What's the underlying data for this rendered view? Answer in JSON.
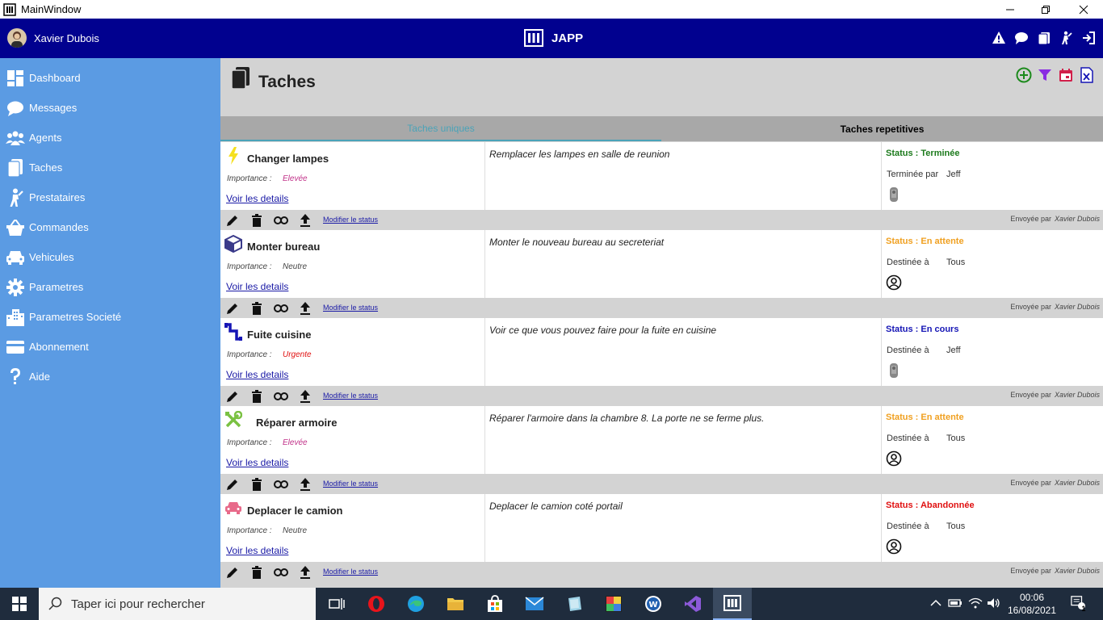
{
  "window": {
    "title": "MainWindow"
  },
  "header": {
    "user_name": "Xavier Dubois",
    "brand": "JAPP"
  },
  "sidebar": {
    "items": [
      {
        "label": "Dashboard",
        "icon": "dashboard-icon"
      },
      {
        "label": "Messages",
        "icon": "chat-icon"
      },
      {
        "label": "Agents",
        "icon": "people-icon"
      },
      {
        "label": "Taches",
        "icon": "clipboard-icon"
      },
      {
        "label": "Prestataires",
        "icon": "worker-icon"
      },
      {
        "label": "Commandes",
        "icon": "basket-icon"
      },
      {
        "label": "Vehicules",
        "icon": "car-icon"
      },
      {
        "label": "Parametres",
        "icon": "gear-icon"
      },
      {
        "label": "Parametres Societé",
        "icon": "building-icon"
      },
      {
        "label": "Abonnement",
        "icon": "credit-card-icon"
      },
      {
        "label": "Aide",
        "icon": "question-icon"
      }
    ]
  },
  "page": {
    "title": "Taches"
  },
  "tabs": [
    {
      "label": "Taches uniques",
      "active": true
    },
    {
      "label": "Taches repetitives",
      "active": false
    }
  ],
  "colors": {
    "header_bg": "#01018f",
    "sidebar_bg": "#5b9be3",
    "main_bg": "#d3d3d3",
    "tab_active": "#4aa3b8",
    "status_terminee": "#1c7a1c",
    "status_attente": "#f0a020",
    "status_cours": "#1515b5",
    "status_abandonnee": "#e01010"
  },
  "tasks": [
    {
      "name": "Changer lampes",
      "icon": "lightning-icon",
      "importance_label": "Importance :",
      "importance": "Elevée",
      "importance_color": "#c03088",
      "details_link": "Voir les details",
      "description": "Remplacer les lampes en salle de reunion",
      "status": "Status : Terminée",
      "status_color": "#1c7a1c",
      "assign_label": "Terminée par",
      "assign_value": "Jeff",
      "assignee_avatar": "photo-avatar",
      "modify_link": "Modifier le status",
      "sent_by_label": "Envoyée par",
      "sent_by": "Xavier Dubois"
    },
    {
      "name": "Monter bureau",
      "icon": "box-icon",
      "importance_label": "Importance :",
      "importance": "Neutre",
      "importance_color": "#444444",
      "details_link": "Voir les details",
      "description": "Monter le nouveau bureau au secreteriat",
      "status": "Status : En attente",
      "status_color": "#f0a020",
      "assign_label": "Destinée à",
      "assign_value": "Tous",
      "assignee_avatar": "user-circle-icon",
      "modify_link": "Modifier le status",
      "sent_by_label": "Envoyée par",
      "sent_by": "Xavier Dubois"
    },
    {
      "name": "Fuite cuisine",
      "icon": "pipe-icon",
      "importance_label": "Importance :",
      "importance": "Urgente",
      "importance_color": "#e01010",
      "details_link": "Voir les details",
      "description": "Voir ce que vous pouvez faire pour la fuite en cuisine",
      "status": "Status : En cours",
      "status_color": "#1515b5",
      "assign_label": "Destinée à",
      "assign_value": "Jeff",
      "assignee_avatar": "photo-avatar",
      "modify_link": "Modifier le status",
      "sent_by_label": "Envoyée par",
      "sent_by": "Xavier Dubois"
    },
    {
      "name": "Réparer armoire",
      "icon": "tools-icon",
      "importance_label": "Importance :",
      "importance": "Elevée",
      "importance_color": "#c03088",
      "details_link": "Voir les details",
      "description": "Réparer l'armoire dans la chambre 8. La porte ne se ferme plus.",
      "status": "Status : En attente",
      "status_color": "#f0a020",
      "assign_label": "Destinée à",
      "assign_value": "Tous",
      "assignee_avatar": "user-circle-icon",
      "modify_link": "Modifier le status",
      "sent_by_label": "Envoyée par",
      "sent_by": "Xavier Dubois"
    },
    {
      "name": "Deplacer le camion",
      "icon": "car-icon",
      "importance_label": "Importance :",
      "importance": "Neutre",
      "importance_color": "#444444",
      "details_link": "Voir les details",
      "description": "Deplacer le camion coté portail",
      "status": "Status : Abandonnée",
      "status_color": "#e01010",
      "assign_label": "Destinée à",
      "assign_value": "Tous",
      "assignee_avatar": "user-circle-icon",
      "modify_link": "Modifier le status",
      "sent_by_label": "Envoyée par",
      "sent_by": "Xavier Dubois"
    }
  ],
  "taskbar": {
    "search_placeholder": "Taper ici pour rechercher",
    "time": "00:06",
    "date": "16/08/2021",
    "notifications": "1"
  }
}
